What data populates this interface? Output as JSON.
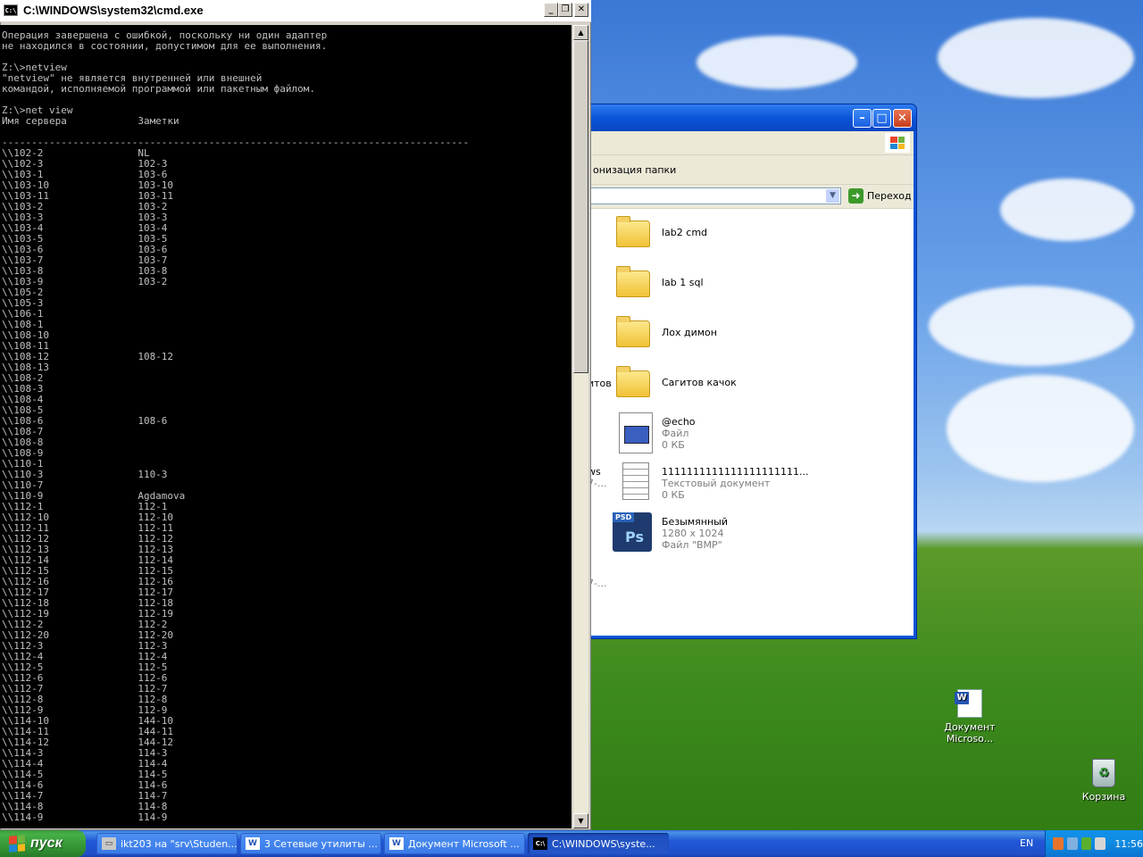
{
  "cmd": {
    "title": "C:\\WINDOWS\\system32\\cmd.exe",
    "icon": "C:\\",
    "output": "Операция завершена с ошибкой, поскольку ни один адаптер\nне находился в состоянии, допустимом для ее выполнения.\n\nZ:\\>netview\n\"netview\" не является внутренней или внешней\nкомандой, исполняемой программой или пакетным файлом.\n\nZ:\\>net view\nИмя сервера            Заметки\n\n-------------------------------------------------------------------------------\n\\\\102-2                NL\n\\\\102-3                102-3\n\\\\103-1                103-6\n\\\\103-10               103-10\n\\\\103-11               103-11\n\\\\103-2                103-2\n\\\\103-3                103-3\n\\\\103-4                103-4\n\\\\103-5                103-5\n\\\\103-6                103-6\n\\\\103-7                103-7\n\\\\103-8                103-8\n\\\\103-9                103-2\n\\\\105-2\n\\\\105-3\n\\\\106-1\n\\\\108-1\n\\\\108-10\n\\\\108-11\n\\\\108-12               108-12\n\\\\108-13\n\\\\108-2\n\\\\108-3\n\\\\108-4\n\\\\108-5\n\\\\108-6                108-6\n\\\\108-7\n\\\\108-8\n\\\\108-9\n\\\\110-1\n\\\\110-3                110-3\n\\\\110-7\n\\\\110-9                Agdamova\n\\\\112-1                112-1\n\\\\112-10               112-10\n\\\\112-11               112-11\n\\\\112-12               112-12\n\\\\112-13               112-13\n\\\\112-14               112-14\n\\\\112-15               112-15\n\\\\112-16               112-16\n\\\\112-17               112-17\n\\\\112-18               112-18\n\\\\112-19               112-19\n\\\\112-2                112-2\n\\\\112-20               112-20\n\\\\112-3                112-3\n\\\\112-4                112-4\n\\\\112-5                112-5\n\\\\112-6                112-6\n\\\\112-7                112-7\n\\\\112-8                112-8\n\\\\112-9                112-9\n\\\\114-10               144-10\n\\\\114-11               144-11\n\\\\114-12               144-12\n\\\\114-3                114-3\n\\\\114-4                114-4\n\\\\114-5                114-5\n\\\\114-6                114-6\n\\\\114-7                114-7\n\\\\114-8                114-8\n\\\\114-9                114-9"
  },
  "explorer": {
    "toolbar_text": "онизация папки",
    "go_label": "Переход",
    "left_fragments": [
      "итов",
      "ws",
      "7-...",
      "7-..."
    ],
    "files": [
      {
        "name": "lab2 cmd",
        "type": "folder"
      },
      {
        "name": "lab 1 sql",
        "type": "folder"
      },
      {
        "name": "Лох димон",
        "type": "folder"
      },
      {
        "name": "Сагитов качок",
        "type": "folder"
      },
      {
        "name": "@echo",
        "sub1": "Файл",
        "sub2": "0 КБ",
        "type": "batch"
      },
      {
        "name": "1111111111111111111111...",
        "sub1": "Текстовый документ",
        "sub2": "0 КБ",
        "type": "text"
      },
      {
        "name": "Безымянный",
        "sub1": "1280 x 1024",
        "sub2": "Файл \"BMP\"",
        "type": "psd"
      }
    ]
  },
  "desktop": {
    "icons": [
      {
        "label": "Документ Microso...",
        "icon": "word-doc-icon"
      },
      {
        "label": "Корзина",
        "icon": "recycle-bin-icon"
      }
    ]
  },
  "taskbar": {
    "start_label": "пуск",
    "buttons": [
      {
        "label": "ikt203 на \"srv\\Studen...",
        "icon": "network-drive-icon",
        "active": false
      },
      {
        "label": "3 Сетевые утилиты ...",
        "icon": "word-icon",
        "active": false
      },
      {
        "label": "Документ Microsoft ...",
        "icon": "word-icon",
        "active": false
      },
      {
        "label": "C:\\WINDOWS\\syste...",
        "icon": "cmd-icon",
        "active": true
      }
    ],
    "language": "EN",
    "clock": "11:56"
  }
}
